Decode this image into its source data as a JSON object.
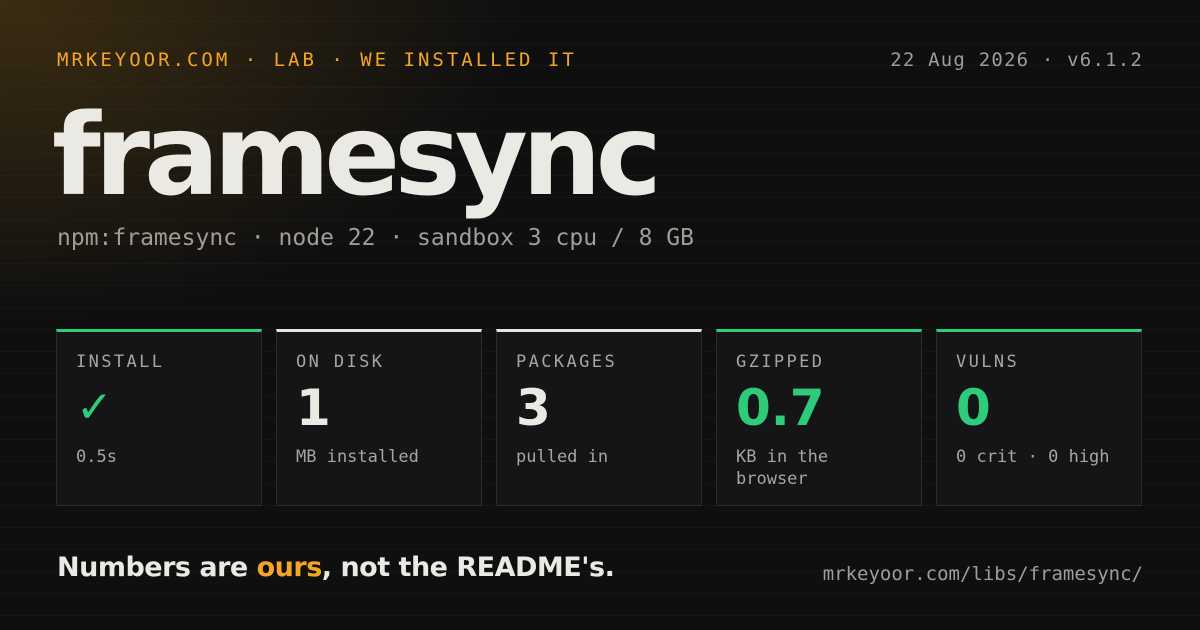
{
  "header": {
    "left_meta": "MRKEYOOR.COM · LAB · WE INSTALLED IT",
    "right_meta": "22 Aug 2026 · v6.1.2"
  },
  "title": "framesync",
  "subtitle": "npm:framesync · node 22 · sandbox 3 cpu / 8 GB",
  "cards": [
    {
      "label": "INSTALL",
      "value": "✓",
      "sub": "0.5s",
      "accent_color": "#2ecc7a",
      "value_color": "#2ecc7a",
      "value_icon": "check-icon"
    },
    {
      "label": "ON DISK",
      "value": "1",
      "sub": "MB installed",
      "accent_color": "#e4e3df",
      "value_color": "#ebe9e4"
    },
    {
      "label": "PACKAGES",
      "value": "3",
      "sub": "pulled in",
      "accent_color": "#e4e3df",
      "value_color": "#ebe9e4"
    },
    {
      "label": "GZIPPED",
      "value": "0.7",
      "sub": "KB in the browser",
      "accent_color": "#2ecc7a",
      "value_color": "#2ecc7a"
    },
    {
      "label": "VULNS",
      "value": "0",
      "sub": "0 crit · 0 high",
      "accent_color": "#2ecc7a",
      "value_color": "#2ecc7a"
    }
  ],
  "footer": {
    "tagline_before": "Numbers are ",
    "tagline_accent": "ours",
    "tagline_after": ", not the README's.",
    "url": "mrkeyoor.com/libs/framesync/"
  },
  "colors": {
    "amber_accent": "#f4a527",
    "green_ok": "#2ecc7a",
    "background": "#0f0f10",
    "text_primary": "#ebe9e4",
    "text_muted": "#a19d96"
  }
}
